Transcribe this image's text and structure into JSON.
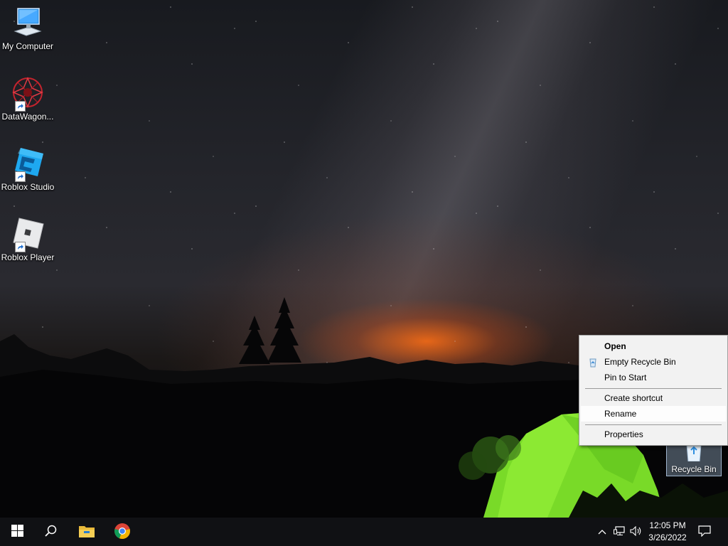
{
  "desktop": {
    "icons": [
      {
        "label": "My Computer",
        "icon": "computer-icon"
      },
      {
        "label": "DataWagon...",
        "icon": "datawagon-icon"
      },
      {
        "label": "Roblox Studio",
        "icon": "roblox-studio-icon"
      },
      {
        "label": "Roblox Player",
        "icon": "roblox-player-icon"
      }
    ],
    "recycle_bin": {
      "label": "Recycle Bin",
      "icon": "recycle-bin-icon"
    }
  },
  "context_menu": {
    "items": [
      {
        "label": "Open",
        "bold": true
      },
      {
        "label": "Empty Recycle Bin",
        "icon": "recycle-small-icon"
      },
      {
        "label": "Pin to Start"
      },
      {
        "label": "Create shortcut"
      },
      {
        "label": "Rename",
        "highlighted": true
      },
      {
        "label": "Properties"
      }
    ]
  },
  "taskbar": {
    "buttons": [
      {
        "icon": "windows-start-icon"
      },
      {
        "icon": "search-icon"
      },
      {
        "icon": "file-explorer-icon"
      },
      {
        "icon": "chrome-icon"
      }
    ],
    "tray": {
      "icons": [
        "chevron-up-icon",
        "network-icon",
        "volume-icon"
      ],
      "time": "12:05 PM",
      "date": "3/26/2022",
      "notification_icon": "notification-icon"
    }
  },
  "colors": {
    "taskbar_bg": "#101114",
    "menu_bg": "#f2f2f2",
    "tent_green": "#7fe62a",
    "glow_orange": "#ff6e14"
  }
}
